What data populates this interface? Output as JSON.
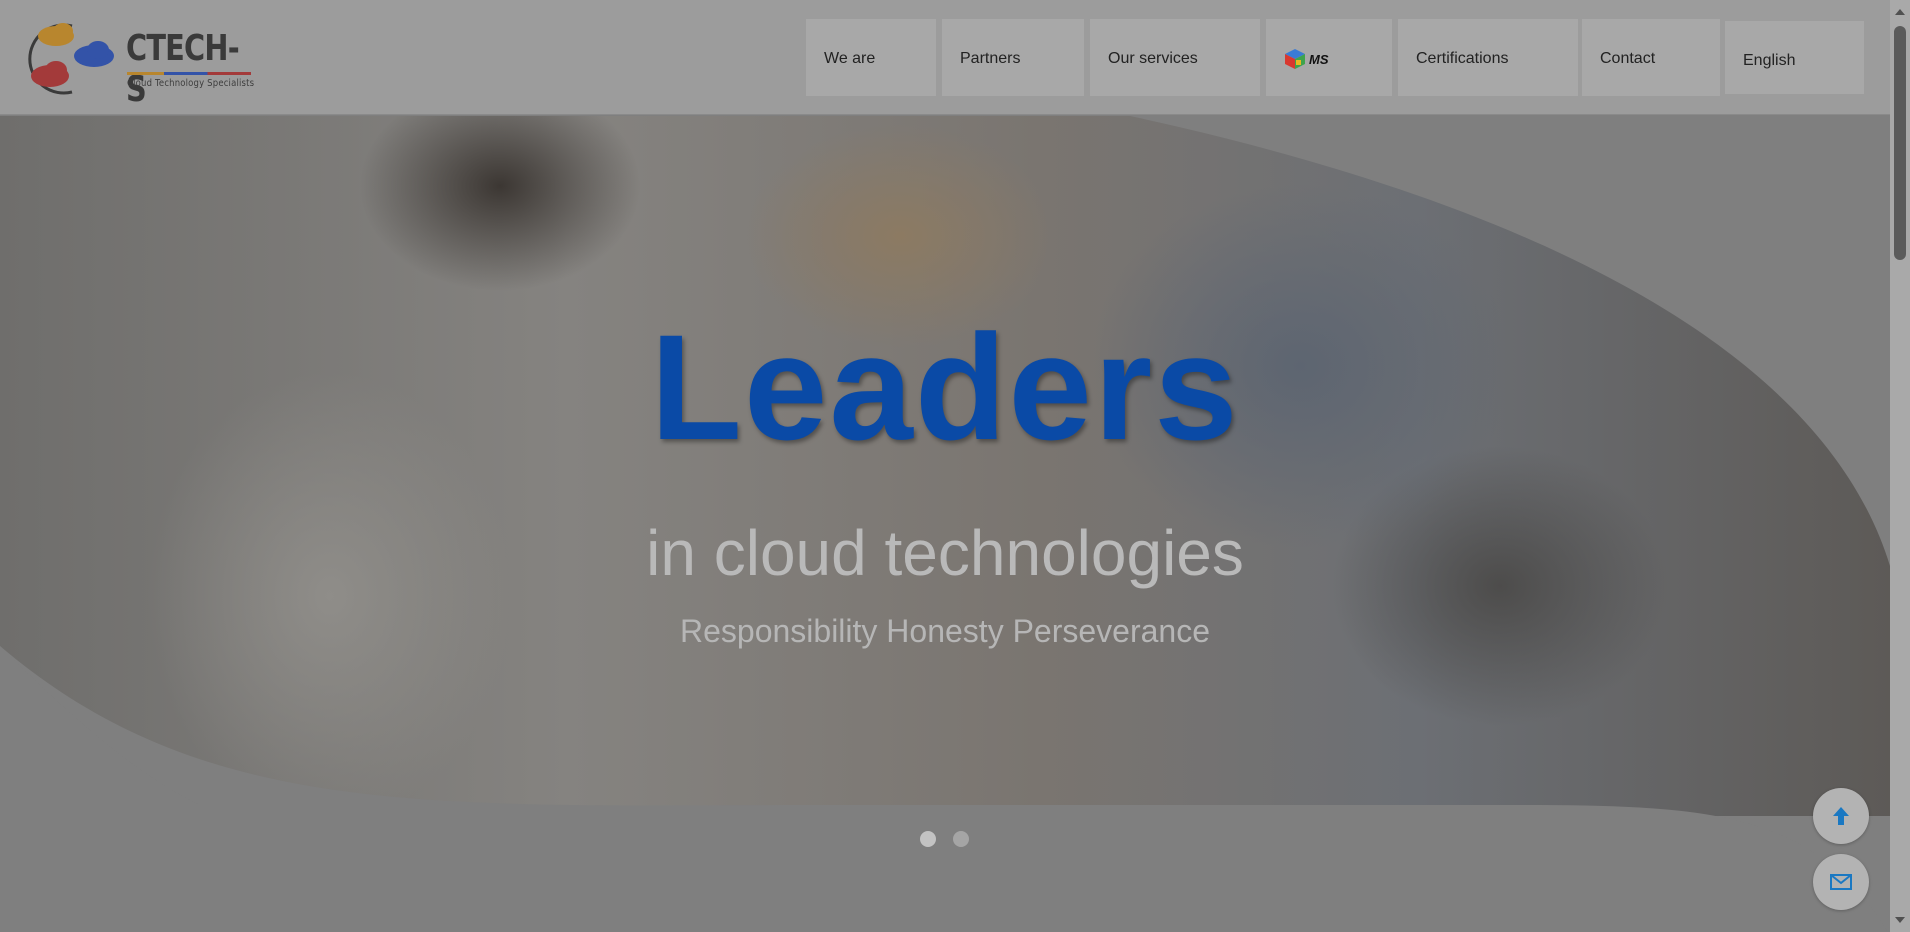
{
  "brand": {
    "name": "CTECH-S",
    "tagline": "Cloud Technology Specialists"
  },
  "nav": {
    "items": [
      {
        "label": "We are"
      },
      {
        "label": "Partners"
      },
      {
        "label": "Our services"
      },
      {
        "label": "MS",
        "icon": "ms-cube-icon"
      },
      {
        "label": "Certifications"
      },
      {
        "label": "Contact"
      }
    ],
    "language": "English"
  },
  "hero": {
    "title": "Leaders",
    "subtitle": "in cloud technologies",
    "tagline": "Responsibility Honesty Perseverance",
    "slides": 2,
    "active_slide": 1
  },
  "floating": {
    "scroll_top_icon": "arrow-up-icon",
    "mail_icon": "mail-icon"
  },
  "colors": {
    "accent": "#0a4aa6",
    "overlay": "#7f7f7f"
  }
}
